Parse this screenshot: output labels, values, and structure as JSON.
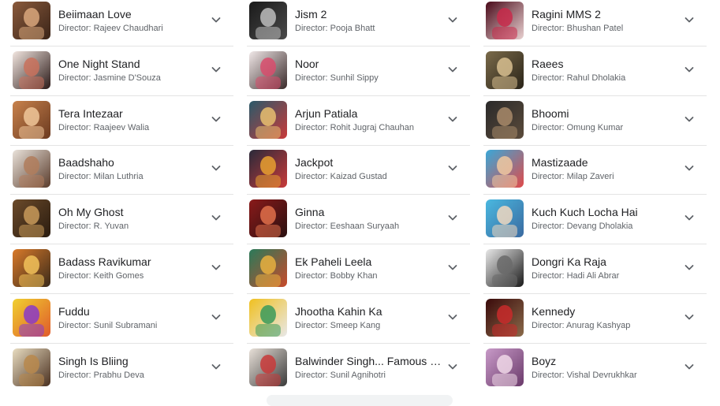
{
  "columns": [
    [
      {
        "title": "Beiimaan Love",
        "director": "Director: Rajeev Chaudhari",
        "colors": [
          "#8a5a3c",
          "#d9a77c",
          "#3a2418"
        ]
      },
      {
        "title": "One Night Stand",
        "director": "Director: Jasmine D'Souza",
        "colors": [
          "#f2e6e0",
          "#c9715c",
          "#2b1a18"
        ]
      },
      {
        "title": "Tera Intezaar",
        "director": "Director: Raajeev Walia",
        "colors": [
          "#c8824c",
          "#f0c79a",
          "#6b3a20"
        ]
      },
      {
        "title": "Baadshaho",
        "director": "Director: Milan Luthria",
        "colors": [
          "#e9e2da",
          "#b07c5c",
          "#5a3c2c"
        ]
      },
      {
        "title": "Oh My Ghost",
        "director": "Director: R. Yuvan",
        "colors": [
          "#6b4a2a",
          "#c89a5a",
          "#2a1c10"
        ]
      },
      {
        "title": "Badass Ravikumar",
        "director": "Director: Keith Gomes",
        "colors": [
          "#d97a2a",
          "#f2c25a",
          "#3a2a1a"
        ]
      },
      {
        "title": "Fuddu",
        "director": "Director: Sunil Subramani",
        "colors": [
          "#f0d030",
          "#8a3ac8",
          "#e05a2a"
        ]
      },
      {
        "title": "Singh Is Bliing",
        "director": "Director: Prabhu Deva",
        "colors": [
          "#e8dcc0",
          "#b8884c",
          "#4a3020"
        ]
      }
    ],
    [
      {
        "title": "Jism 2",
        "director": "Director: Pooja Bhatt",
        "colors": [
          "#1a1a1a",
          "#bdbdbd",
          "#4a4a4a"
        ]
      },
      {
        "title": "Noor",
        "director": "Director: Sunhil Sippy",
        "colors": [
          "#f0e8e8",
          "#d84c6c",
          "#3a2a2a"
        ]
      },
      {
        "title": "Arjun Patiala",
        "director": "Director: Rohit Jugraj Chauhan",
        "colors": [
          "#2a5a6a",
          "#e8c070",
          "#c83a3a"
        ]
      },
      {
        "title": "Jackpot",
        "director": "Director: Kaizad Gustad",
        "colors": [
          "#2a2a3a",
          "#e8a030",
          "#c83a3a"
        ]
      },
      {
        "title": "Ginna",
        "director": "Director: Eeshaan Suryaah",
        "colors": [
          "#8a1a1a",
          "#e0704a",
          "#2a1010"
        ]
      },
      {
        "title": "Ek Paheli Leela",
        "director": "Director: Bobby Khan",
        "colors": [
          "#2a7a5a",
          "#e8b040",
          "#c84a2a"
        ]
      },
      {
        "title": "Jhootha Kahin Ka",
        "director": "Director: Smeep Kang",
        "colors": [
          "#f0c020",
          "#3a9a5a",
          "#e8e8e8"
        ]
      },
      {
        "title": "Balwinder Singh... Famous H...",
        "director": "Director: Sunil Agnihotri",
        "colors": [
          "#e8e0d8",
          "#c83a3a",
          "#3a3a3a"
        ]
      }
    ],
    [
      {
        "title": "Ragini MMS 2",
        "director": "Director: Bhushan Patel",
        "colors": [
          "#4a0a1a",
          "#c82a4a",
          "#e8d0d0"
        ]
      },
      {
        "title": "Raees",
        "director": "Director: Rahul Dholakia",
        "colors": [
          "#7a6a4a",
          "#d8c090",
          "#2a2418"
        ]
      },
      {
        "title": "Bhoomi",
        "director": "Director: Omung Kumar",
        "colors": [
          "#2a2a2a",
          "#a88a6a",
          "#5a4a3a"
        ]
      },
      {
        "title": "Mastizaade",
        "director": "Director: Milap Zaveri",
        "colors": [
          "#3aa8d8",
          "#f0c8a0",
          "#e04a4a"
        ]
      },
      {
        "title": "Kuch Kuch Locha Hai",
        "director": "Director: Devang Dholakia",
        "colors": [
          "#4ab8e0",
          "#f0d8c0",
          "#3a6aa0"
        ]
      },
      {
        "title": "Dongri Ka Raja",
        "director": "Director: Hadi Ali Abrar",
        "colors": [
          "#e8e8e8",
          "#6a6a6a",
          "#1a1a1a"
        ]
      },
      {
        "title": "Kennedy",
        "director": "Director: Anurag Kashyap",
        "colors": [
          "#3a0a0a",
          "#c82a2a",
          "#8a6a4a"
        ]
      },
      {
        "title": "Boyz",
        "director": "Director: Vishal Devrukhkar",
        "colors": [
          "#c89ac8",
          "#f0d8e8",
          "#6a3a6a"
        ]
      }
    ]
  ]
}
